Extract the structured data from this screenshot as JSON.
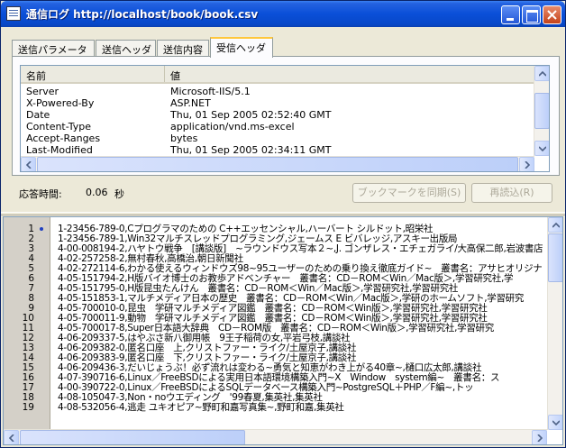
{
  "window": {
    "title": "通信ログ http://localhost/book/book.csv"
  },
  "tabs": [
    {
      "label": "送信パラメータ",
      "active": false
    },
    {
      "label": "送信ヘッダ",
      "active": false
    },
    {
      "label": "送信内容",
      "active": false
    },
    {
      "label": "受信ヘッダ",
      "active": true
    }
  ],
  "headers_table": {
    "columns": [
      "名前",
      "値"
    ],
    "rows": [
      {
        "name": "Server",
        "value": "Microsoft-IIS/5.1"
      },
      {
        "name": "X-Powered-By",
        "value": "ASP.NET"
      },
      {
        "name": "Date",
        "value": "Thu, 01 Sep 2005 02:52:40 GMT"
      },
      {
        "name": "Content-Type",
        "value": "application/vnd.ms-excel"
      },
      {
        "name": "Accept-Ranges",
        "value": "bytes"
      },
      {
        "name": "Last-Modified",
        "value": "Thu, 01 Sep 2005 02:34:11 GMT"
      }
    ]
  },
  "response": {
    "label": "応答時間:",
    "value": "0.06",
    "unit": "秒"
  },
  "buttons": {
    "bookmark_sync": "ブックマークを同期(S)",
    "reload": "再読込(R)"
  },
  "log_lines": [
    {
      "n": "1",
      "text": "1-23456-789-0,Cプログラマのための C++エッセンシャル,ハーバート シルドット,昭栄社",
      "marked": true
    },
    {
      "n": "2",
      "text": "1-23456-789-1,Win32マルチスレッドプログラミング,ジェームス E ビバレッジ,アスキー出版局",
      "marked": false
    },
    {
      "n": "3",
      "text": "4-00-008194-2,ハヤトウ戦争　[講談版]　~ラウンドウス写本２~,J. ゴンザレス・エチェガライ/大高保二郎,岩波書店",
      "marked": false
    },
    {
      "n": "4",
      "text": "4-02-257258-2,無村春秋,高橋治,朝日新聞社",
      "marked": false
    },
    {
      "n": "5",
      "text": "4-02-272114-6,わかる使えるウィンドウズ98~95ユーザーのための乗り換え徹底ガイド~　叢書名：アサヒオリジナ",
      "marked": false
    },
    {
      "n": "6",
      "text": "4-05-151794-2,H版バイオ博士のお教歩アドベンチャー　叢書名：CD－ROM＜Win／Mac版＞,学習研究社,学",
      "marked": false
    },
    {
      "n": "7",
      "text": "4-05-151795-0,H版昆虫たんけん　叢書名：CD－ROM＜Win／Mac版＞,学習研究社,学習研究社",
      "marked": false
    },
    {
      "n": "8",
      "text": "4-05-151853-1,マルチメディア日本の歴史　叢書名：CD－ROM＜Win／Mac版＞,学研のホームソフト,学習研究",
      "marked": false
    },
    {
      "n": "9",
      "text": "4-05-700010-0,昆虫　学研マルチメディア図鑑　叢書名：CD－ROM＜Win版＞,学習研究社,学習研究社",
      "marked": false
    },
    {
      "n": "10",
      "text": "4-05-700011-9,動物　学研マルチメディア図鑑　叢書名：CD－ROM＜Win版＞,学習研究社,学習研究社",
      "marked": false
    },
    {
      "n": "11",
      "text": "4-05-700017-8,Super日本語大辞典　CD－ROM版　叢書名：CD－ROM＜Win版＞,学習研究社,学習研究",
      "marked": false
    },
    {
      "n": "12",
      "text": "4-06-209337-5,はやぶさ新八御用帳　9王子稲荷の女,平岩弓枝,講談社",
      "marked": false
    },
    {
      "n": "13",
      "text": "4-06-209382-0,匿名口座　上,クリストファー・ライク/土屋京子,講談社",
      "marked": false
    },
    {
      "n": "14",
      "text": "4-06-209383-9,匿名口座　下,クリストファー・ライク/土屋京子,講談社",
      "marked": false
    },
    {
      "n": "15",
      "text": "4-06-209436-3,だいじょうぶ！必ず流れは変わる~勇気と知恵がわき上がる40章~,樋口広太郎,講談社",
      "marked": false
    },
    {
      "n": "16",
      "text": "4-07-390716-6,Linux／FreeBSDによる実用日本語環境構築入門~X　Window　system編~　叢書名：ス",
      "marked": false
    },
    {
      "n": "17",
      "text": "4-00-390722-0,Linux／FreeBSDによるSQLデータベース構築入門~PostgreSQL＋PHP／F編~,トッ",
      "marked": false
    },
    {
      "n": "18",
      "text": "4-08-105047-3,Non・noウエディング　'99春夏,集英社,集英社",
      "marked": false
    },
    {
      "n": "19",
      "text": "4-08-532056-4,逃走 ユキオピア~野町和嘉写真集~,野町和嘉,集英社",
      "marked": false
    }
  ]
}
